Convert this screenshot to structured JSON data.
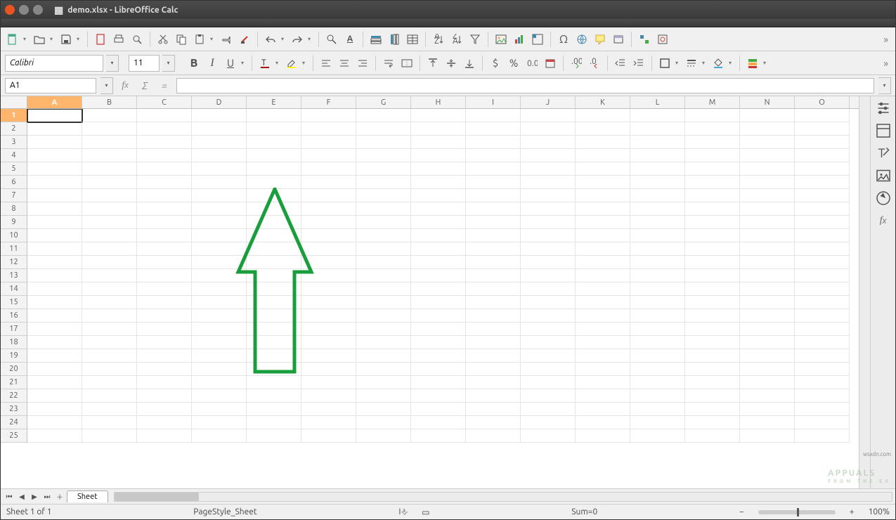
{
  "window": {
    "title": "demo.xlsx - LibreOffice Calc"
  },
  "font": {
    "name": "Calibri",
    "size": "11"
  },
  "namebox": {
    "ref": "A1"
  },
  "formula": {
    "value": ""
  },
  "columns": [
    "A",
    "B",
    "C",
    "D",
    "E",
    "F",
    "G",
    "H",
    "I",
    "J",
    "K",
    "L",
    "M",
    "N",
    "O"
  ],
  "rows": [
    "1",
    "2",
    "3",
    "4",
    "5",
    "6",
    "7",
    "8",
    "9",
    "10",
    "11",
    "12",
    "13",
    "14",
    "15",
    "16",
    "17",
    "18",
    "19",
    "20",
    "21",
    "22",
    "23",
    "24",
    "25"
  ],
  "active_cell": {
    "col": 0,
    "row": 0
  },
  "sheet_tabs": {
    "active": "Sheet"
  },
  "status": {
    "sheet_count": "Sheet 1 of 1",
    "page_style": "PageStyle_Sheet",
    "sum": "Sum=0",
    "zoom": "100%"
  },
  "icons": {
    "new": "new-doc",
    "open": "open",
    "save": "save",
    "pdf": "pdf",
    "print": "print",
    "preview": "preview",
    "cut": "cut",
    "copy": "copy",
    "paste": "paste",
    "clone": "clone",
    "brush": "brush",
    "undo": "undo",
    "redo": "redo",
    "find": "find",
    "spell": "spell",
    "row": "row",
    "col": "col",
    "table": "table",
    "sort_asc": "sort-asc",
    "sort_desc": "sort-desc",
    "filter": "filter",
    "img": "image",
    "chart": "chart",
    "pivot": "pivot",
    "special": "Ω",
    "link": "link",
    "comment": "comment",
    "header": "header",
    "draw": "draw",
    "frame": "frame",
    "bold": "B",
    "italic": "I",
    "underline": "U",
    "fontcolor": "font-color",
    "highlight": "highlight",
    "align_l": "align-left",
    "align_c": "align-center",
    "align_r": "align-right",
    "wrap": "wrap",
    "merge": "merge",
    "valign_t": "valign-top",
    "valign_m": "valign-mid",
    "valign_b": "valign-bot",
    "currency": "$",
    "percent": "%",
    "number": "number",
    "date": "date",
    "dec_add": "dec-add",
    "dec_rem": "dec-rem",
    "indent_dec": "indent-dec",
    "indent_inc": "indent-inc",
    "border": "border",
    "border_style": "border-style",
    "bgcolor": "bg-color",
    "cond": "cond-format",
    "side_props": "props",
    "side_styles": "styles",
    "side_gallery": "gallery",
    "side_nav": "nav",
    "side_fx": "fx"
  },
  "watermark": {
    "brand": "APPUALS",
    "tag": "FROM THE EX",
    "src": "wsxdn.com"
  }
}
